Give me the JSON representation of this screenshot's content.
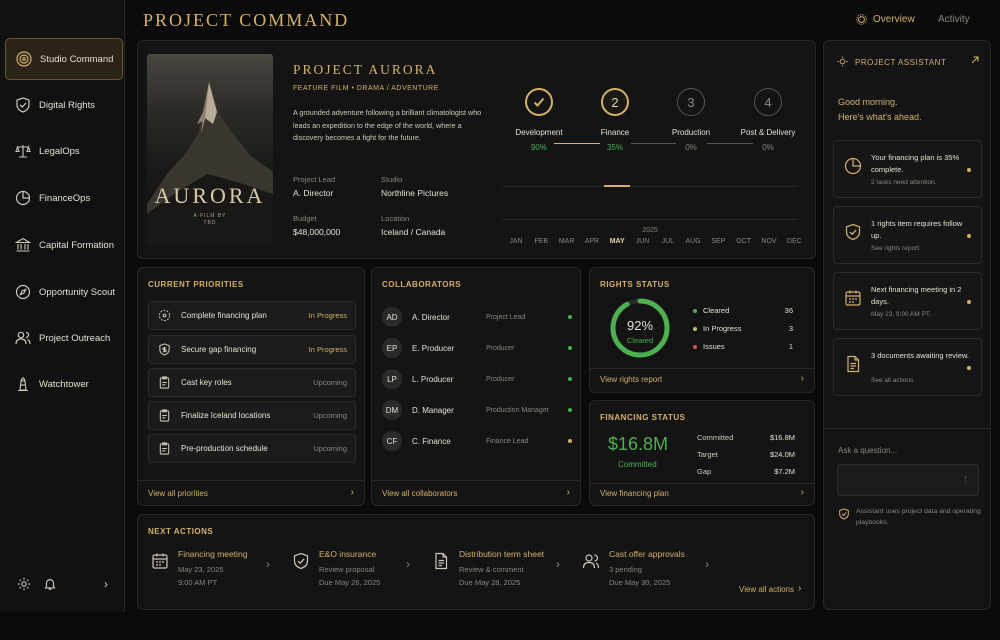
{
  "app_title": "PROJECT COMMAND",
  "top_tabs": [
    {
      "label": "Overview"
    },
    {
      "label": "Activity"
    }
  ],
  "sidebar": {
    "items": [
      {
        "label": "Studio Command"
      },
      {
        "label": "Digital Rights"
      },
      {
        "label": "LegalOps"
      },
      {
        "label": "FinanceOps"
      },
      {
        "label": "Capital Formation"
      },
      {
        "label": "Opportunity Scout"
      },
      {
        "label": "Project Outreach"
      },
      {
        "label": "Watchtower"
      }
    ]
  },
  "project": {
    "poster_title": "AURORA",
    "poster_sub1": "A FILM BY",
    "poster_sub2": "TBD",
    "title": "PROJECT AURORA",
    "genre": "FEATURE FILM  •  DRAMA / ADVENTURE",
    "description": "A grounded adventure following a brilliant climatologist who leads an expedition to the edge of the world, where a discovery becomes a fight for the future.",
    "lead_label": "Project Lead",
    "lead": "A. Director",
    "studio_label": "Studio",
    "studio": "Northline Pictures",
    "budget_label": "Budget",
    "budget": "$48,000,000",
    "location_label": "Location",
    "location": "Iceland / Canada"
  },
  "stages": [
    {
      "num": "✓",
      "name": "Development",
      "pct": "90%"
    },
    {
      "num": "2",
      "name": "Finance",
      "pct": "35%"
    },
    {
      "num": "3",
      "name": "Production",
      "pct": "0%"
    },
    {
      "num": "4",
      "name": "Post & Delivery",
      "pct": "0%"
    }
  ],
  "timeline": {
    "months": [
      "JAN",
      "FEB",
      "MAR",
      "APR",
      "MAY",
      "JUN",
      "JUL",
      "AUG",
      "SEP",
      "OCT",
      "NOV",
      "DEC"
    ],
    "year": "2025"
  },
  "priorities": {
    "title": "CURRENT PRIORITIES",
    "items": [
      {
        "name": "Complete financing plan",
        "status": "In Progress",
        "icon": "target-icon"
      },
      {
        "name": "Secure gap financing",
        "status": "In Progress",
        "icon": "shield-dollar-icon"
      },
      {
        "name": "Cast key roles",
        "status": "Upcoming",
        "icon": "clipboard-icon"
      },
      {
        "name": "Finalize Iceland locations",
        "status": "Upcoming",
        "icon": "clipboard-icon"
      },
      {
        "name": "Pre-production schedule",
        "status": "Upcoming",
        "icon": "clipboard-icon"
      }
    ],
    "footer": "View all priorities"
  },
  "collaborators": {
    "title": "COLLABORATORS",
    "items": [
      {
        "initials": "AD",
        "name": "A. Director",
        "role": "Project Lead",
        "color": "#4caf50"
      },
      {
        "initials": "EP",
        "name": "E. Producer",
        "role": "Producer",
        "color": "#4caf50"
      },
      {
        "initials": "LP",
        "name": "L. Producer",
        "role": "Producer",
        "color": "#4caf50"
      },
      {
        "initials": "DM",
        "name": "D. Manager",
        "role": "Production Manager",
        "color": "#4caf50"
      },
      {
        "initials": "CF",
        "name": "C. Finance",
        "role": "Finance Lead",
        "color": "#d4b06a"
      }
    ],
    "footer": "View all collaborators"
  },
  "rights": {
    "title": "RIGHTS STATUS",
    "pct": "92%",
    "pct_value": 0.92,
    "pct_label": "Cleared",
    "legend": [
      {
        "label": "Cleared",
        "value": "36",
        "color": "#4caf50"
      },
      {
        "label": "In Progress",
        "value": "3",
        "color": "#d4b06a"
      },
      {
        "label": "Issues",
        "value": "1",
        "color": "#d9534f"
      }
    ],
    "footer": "View rights report"
  },
  "financing": {
    "title": "FINANCING STATUS",
    "amount": "$16.8M",
    "amount_label": "Committed",
    "rows": [
      {
        "label": "Committed",
        "value": "$16.8M"
      },
      {
        "label": "Target",
        "value": "$24.0M"
      },
      {
        "label": "Gap",
        "value": "$7.2M"
      }
    ],
    "footer": "View financing plan"
  },
  "next_actions": {
    "title": "NEXT ACTIONS",
    "items": [
      {
        "title": "Financing meeting",
        "line1": "May 23, 2025",
        "line2": "9:00 AM PT"
      },
      {
        "title": "E&O insurance",
        "line1": "Review proposal",
        "line2": "Due May 26, 2025"
      },
      {
        "title": "Distribution term sheet",
        "line1": "Review & comment",
        "line2": "Due May 28, 2025"
      },
      {
        "title": "Cast offer approvals",
        "line1": "3 pending",
        "line2": "Due May 30, 2025"
      }
    ],
    "footer": "View all actions"
  },
  "assistant": {
    "title": "PROJECT ASSISTANT",
    "greeting1": "Good morning.",
    "greeting2": "Here's what's ahead.",
    "cards": [
      {
        "text": "Your financing plan is 35% complete.",
        "sub": "2 tasks need attention."
      },
      {
        "text": "1 rights item requires follow up.",
        "sub": "See rights report."
      },
      {
        "text": "Next financing meeting in 2 days.",
        "sub": "May 23, 9:00 AM PT."
      },
      {
        "text": "3 documents awaiting review.",
        "sub": "See all actions."
      }
    ],
    "ask_label": "Ask a question...",
    "note": "Assistant uses project data and operating playbooks."
  }
}
